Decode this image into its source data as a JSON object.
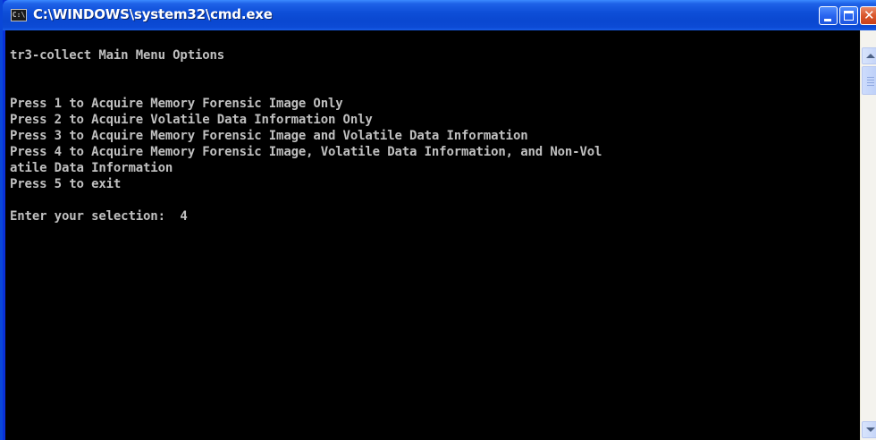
{
  "window": {
    "title": "C:\\WINDOWS\\system32\\cmd.exe",
    "icon": "cmd-icon",
    "icon_text": "C:\\",
    "controls": {
      "minimize": "minimize-icon",
      "maximize": "maximize-icon",
      "close": "close-icon"
    }
  },
  "console": {
    "lines": [
      "tr3-collect Main Menu Options",
      "",
      "",
      "Press 1 to Acquire Memory Forensic Image Only",
      "Press 2 to Acquire Volatile Data Information Only",
      "Press 3 to Acquire Memory Forensic Image and Volatile Data Information",
      "Press 4 to Acquire Memory Forensic Image, Volatile Data Information, and Non-Vol",
      "atile Data Information",
      "Press 5 to exit",
      "",
      "Enter your selection:  4"
    ],
    "text_color": "#c0c0c0",
    "background": "#000000"
  },
  "scrollbar": {
    "up": "scroll-up-icon",
    "down": "scroll-down-icon"
  },
  "colors": {
    "titlebar": "#0a47d0",
    "close_button": "#d9572c"
  }
}
